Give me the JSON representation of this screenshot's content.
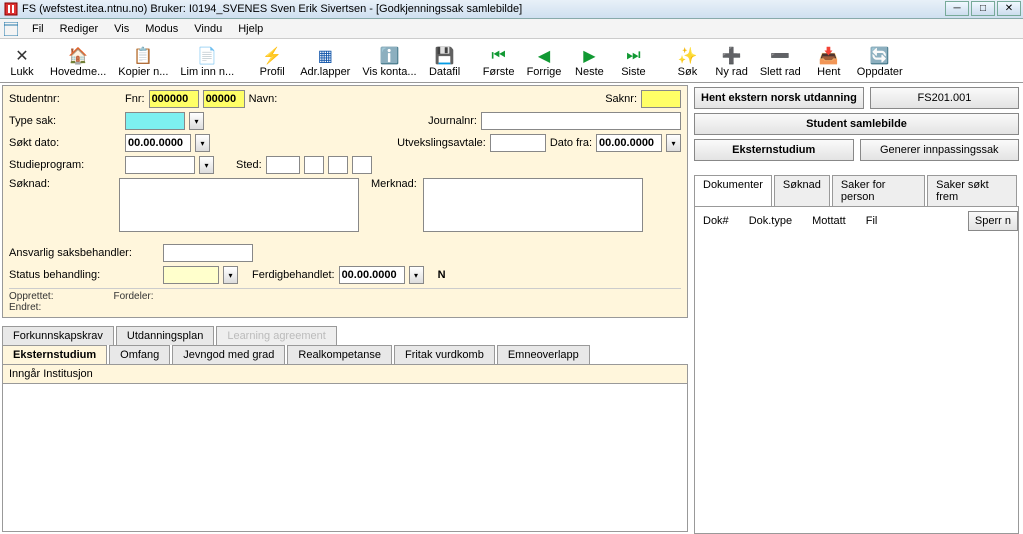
{
  "title": "FS (wefstest.itea.ntnu.no) Bruker: I0194_SVENES Sven Erik Sivertsen - [Godkjenningssak samlebilde]",
  "menu": {
    "items": [
      "Fil",
      "Rediger",
      "Vis",
      "Modus",
      "Vindu",
      "Hjelp"
    ]
  },
  "toolbar": {
    "lukk": "Lukk",
    "hovedme": "Hovedme...",
    "kopier": "Kopier n...",
    "liminn": "Lim inn n...",
    "profil": "Profil",
    "adrlapper": "Adr.lapper",
    "viskonta": "Vis konta...",
    "datafil": "Datafil",
    "forste": "Første",
    "forrige": "Forrige",
    "neste": "Neste",
    "siste": "Siste",
    "sok": "Søk",
    "nyrad": "Ny rad",
    "slettrad": "Slett rad",
    "hent": "Hent",
    "oppdater": "Oppdater"
  },
  "form": {
    "studentnr_label": "Studentnr:",
    "fnr_label": "Fnr:",
    "fnr1": "000000",
    "fnr2": "00000",
    "navn_label": "Navn:",
    "saknr_label": "Saknr:",
    "type_sak_label": "Type sak:",
    "journalnr_label": "Journalnr:",
    "sokt_dato_label": "Søkt dato:",
    "sokt_dato": "00.00.0000",
    "utveksl_label": "Utvekslingsavtale:",
    "dato_fra_label": "Dato fra:",
    "dato_fra": "00.00.0000",
    "studieprogram_label": "Studieprogram:",
    "sted_label": "Sted:",
    "soknad_label": "Søknad:",
    "merknad_label": "Merknad:",
    "ansvarlig_label": "Ansvarlig saksbehandler:",
    "status_label": "Status behandling:",
    "ferdig_label": "Ferdigbehandlet:",
    "ferdig_dato": "00.00.0000",
    "ferdig_flag": "N",
    "opprettet_label": "Opprettet:",
    "endret_label": "Endret:",
    "fordeler_label": "Fordeler:"
  },
  "upper_tabs": {
    "t1": "Forkunnskapskrav",
    "t2": "Utdanningsplan",
    "t3": "Learning agreement"
  },
  "lower_tabs": {
    "t1": "Eksternstudium",
    "t2": "Omfang",
    "t3": "Jevngod med grad",
    "t4": "Realkompetanse",
    "t5": "Fritak vurdkomb",
    "t6": "Emneoverlapp"
  },
  "detail_header": "Inngår Institusjon",
  "right": {
    "b1": "Hent ekstern norsk utdanning",
    "b2": "FS201.001",
    "b3": "Student samlebilde",
    "b4": "Eksternstudium",
    "b5": "Generer innpassingssak",
    "tabs": {
      "t1": "Dokumenter",
      "t2": "Søknad",
      "t3": "Saker for person",
      "t4": "Saker søkt frem"
    },
    "cols": {
      "c1": "Dok#",
      "c2": "Dok.type",
      "c3": "Mottatt",
      "c4": "Fil"
    },
    "sperr": "Sperr n"
  }
}
